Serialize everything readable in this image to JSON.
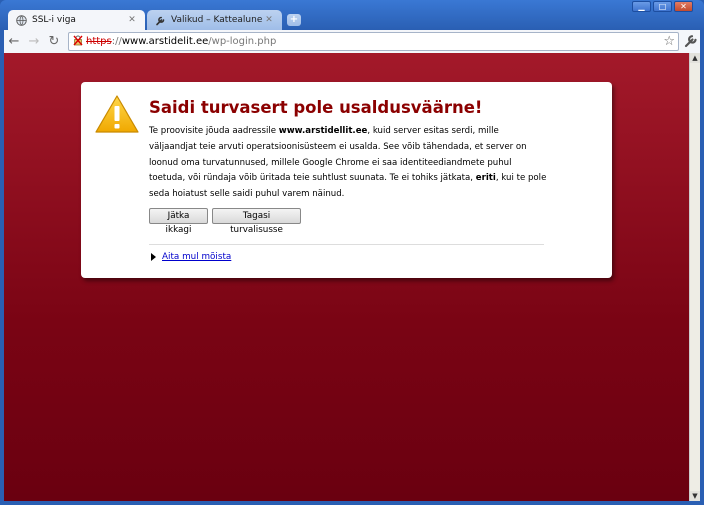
{
  "tabs": [
    {
      "title": "SSL-i viga",
      "active": true,
      "favicon": "globe-icon"
    },
    {
      "title": "Valikud – Kattealune",
      "active": false,
      "favicon": "wrench-icon"
    }
  ],
  "window_controls": {
    "minimize": "▁",
    "maximize": "□",
    "close": "✕"
  },
  "toolbar": {
    "back": "←",
    "forward": "→",
    "reload": "↻",
    "url": {
      "scheme": "https",
      "separator": "://",
      "host": "www.arstidelit.ee",
      "path": "/wp-login.php"
    },
    "star": "☆"
  },
  "interstitial": {
    "title": "Saidi turvasert pole usaldusväärne!",
    "para_start": "Te proovisite jõuda aadressile ",
    "para_host": "www.arstidellit.ee",
    "para_middle": ", kuid server esitas serdi, mille väljaandjat teie arvuti operatsioonisüsteem ei usalda. See võib tähendada, et server on loonud oma turvatunnused, millele Google Chrome ei saa identiteediandmete puhul toetuda, või ründaja võib üritada teie suhtlust suunata. Te ei tohiks jätkata, ",
    "para_bold2": "eriti",
    "para_end": ", kui te pole seda hoiatust selle saidi puhul varem näinud.",
    "continue_button": "Jätka ikkagi",
    "back_button": "Tagasi turvalisusse",
    "help_link": "Aita mul mõista"
  },
  "colors": {
    "background_top": "#a3192a",
    "background_bottom": "#6a0010",
    "title": "#8b0000",
    "link": "#0000cc"
  }
}
